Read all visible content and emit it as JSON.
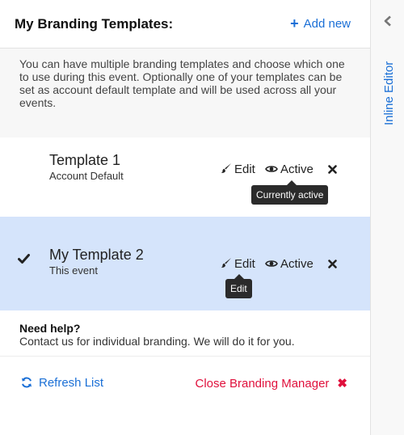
{
  "header": {
    "title": "My Branding Templates:",
    "add_new_label": "Add new"
  },
  "intro": "You can have multiple branding templates and choose which one to use during this event. Optionally one of your templates can be set as account default template and will be used across all your events.",
  "templates": [
    {
      "name": "Template 1",
      "subtitle": "Account Default",
      "edit_label": "Edit",
      "active_label": "Active",
      "selected": false
    },
    {
      "name": "My Template 2",
      "subtitle": "This event",
      "edit_label": "Edit",
      "active_label": "Active",
      "selected": true
    }
  ],
  "tooltips": {
    "active": "Currently active",
    "edit": "Edit"
  },
  "help": {
    "title": "Need help?",
    "text": "Contact us for individual branding. We will do it for you."
  },
  "footer": {
    "refresh_label": "Refresh List",
    "close_label": "Close Branding Manager"
  },
  "sidebar": {
    "label": "Inline Editor"
  },
  "colors": {
    "accent": "#1a6fd6",
    "danger": "#e0103c",
    "selected_row": "#d5e4fb"
  },
  "icons": [
    "plus-icon",
    "brush-icon",
    "eye-icon",
    "close-icon",
    "check-icon",
    "refresh-icon",
    "chevron-left-icon"
  ]
}
